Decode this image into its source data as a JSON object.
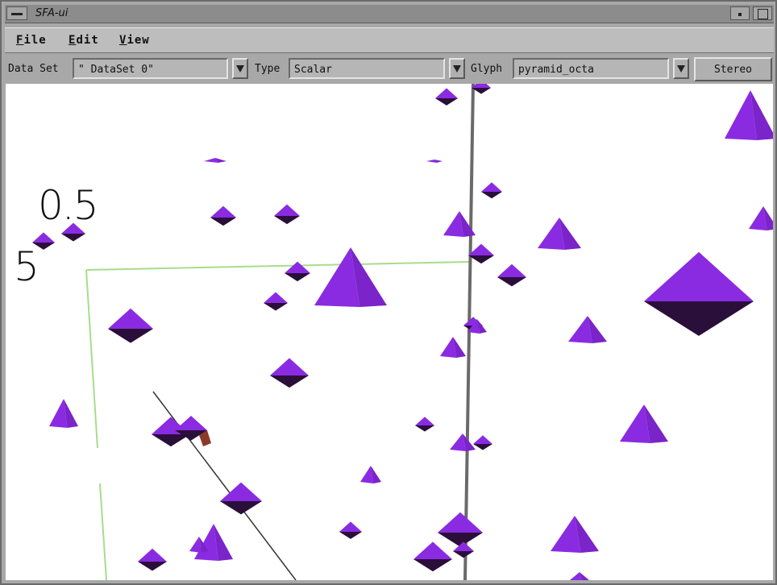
{
  "window": {
    "title": "SFA-ui"
  },
  "menubar": {
    "items": [
      {
        "mnemonic": "F",
        "rest": "ile"
      },
      {
        "mnemonic": "E",
        "rest": "dit"
      },
      {
        "mnemonic": "V",
        "rest": "iew"
      }
    ]
  },
  "toolbar": {
    "dataset_label": "Data Set",
    "dataset_value": "\" DataSet 0\"",
    "type_label": "Type",
    "type_value": "Scalar",
    "glyph_label": "Glyph",
    "glyph_value": "pyramid_octa",
    "stereo_label": "Stereo"
  },
  "viewport": {
    "axis_labels": [
      "0.5",
      "5"
    ],
    "glyph_color": "#8a2be2",
    "glyph_shadow_color": "#2a0f3a",
    "bounding_box_color": "#a8dc8c",
    "axis_line_color": "#6a6a6a",
    "marker_color": "#8b3a2a"
  }
}
